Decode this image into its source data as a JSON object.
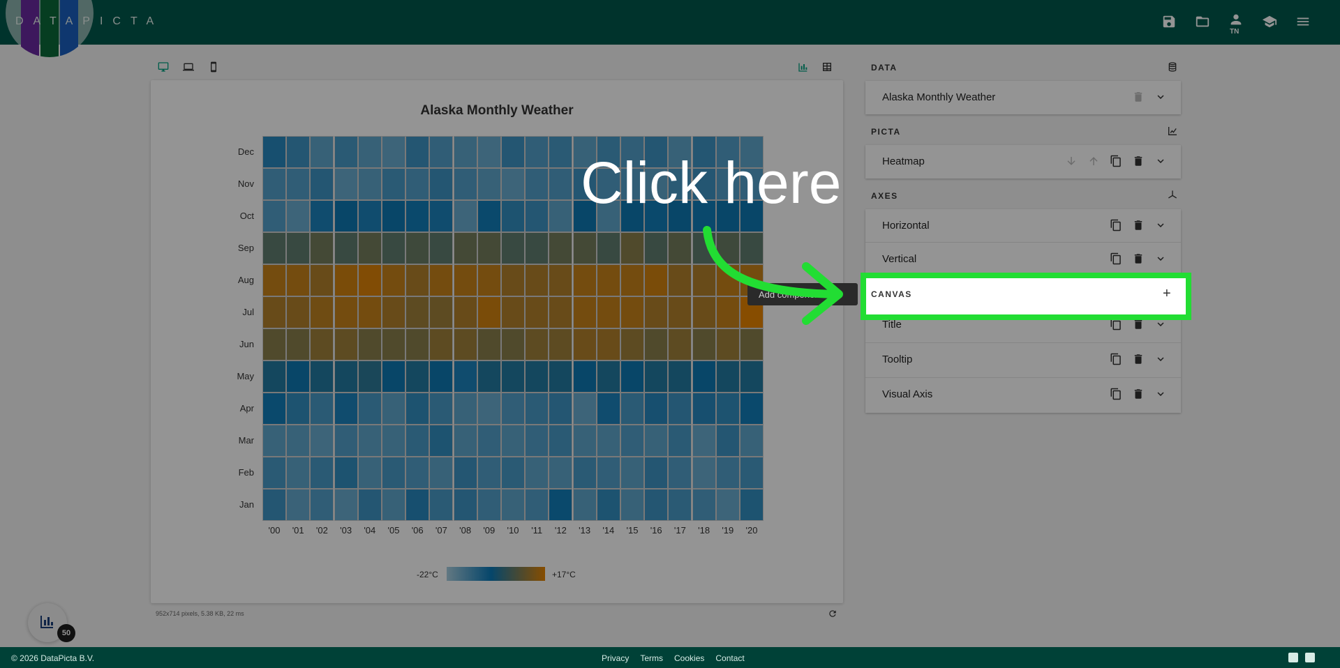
{
  "app": {
    "logo_text": "DATAPICTA",
    "user_initials": "TN"
  },
  "chart": {
    "title": "Alaska Monthly Weather",
    "legend_min": "-22°C",
    "legend_max": "+17°C",
    "stats": "952x714 pixels, 5.38 KB, 22 ms",
    "fab_badge": "50"
  },
  "chart_data": {
    "type": "heatmap",
    "title": "Alaska Monthly Weather",
    "x": [
      "'00",
      "'01",
      "'02",
      "'03",
      "'04",
      "'05",
      "'06",
      "'07",
      "'08",
      "'09",
      "'10",
      "'11",
      "'12",
      "'13",
      "'14",
      "'15",
      "'16",
      "'17",
      "'18",
      "'19",
      "'20"
    ],
    "y": [
      "Jan",
      "Feb",
      "Mar",
      "Apr",
      "May",
      "Jun",
      "Jul",
      "Aug",
      "Sep",
      "Oct",
      "Nov",
      "Dec"
    ],
    "color_range": [
      "-22°C",
      "+17°C"
    ],
    "colors": [
      "#a9cfe0",
      "#0a79b8",
      "#e88500"
    ],
    "values": [
      [
        -14,
        -21,
        -18,
        -22,
        -14,
        -20,
        -10,
        -16,
        -14,
        -18,
        -20,
        -18,
        -6,
        -20,
        -12,
        -20,
        -14,
        -16,
        -18,
        -22,
        -12
      ],
      [
        -16,
        -20,
        -16,
        -12,
        -20,
        -16,
        -18,
        -20,
        -14,
        -18,
        -16,
        -20,
        -20,
        -16,
        -18,
        -20,
        -14,
        -18,
        -22,
        -18,
        -16
      ],
      [
        -20,
        -20,
        -22,
        -18,
        -20,
        -20,
        -16,
        -12,
        -20,
        -18,
        -20,
        -18,
        -16,
        -20,
        -20,
        -18,
        -20,
        -16,
        -22,
        -14,
        -20
      ],
      [
        -6,
        -12,
        -16,
        -8,
        -16,
        -20,
        -12,
        -16,
        -20,
        -22,
        -18,
        -16,
        -14,
        -22,
        -8,
        -16,
        -10,
        -14,
        -10,
        -12,
        -6
      ],
      [
        -2,
        -4,
        -2,
        -2,
        -1,
        -4,
        -2,
        -4,
        -8,
        -2,
        -2,
        -2,
        -2,
        -4,
        -2,
        -4,
        -2,
        -2,
        -4,
        -2,
        -2
      ],
      [
        8,
        8,
        10,
        10,
        8,
        8,
        8,
        10,
        10,
        8,
        8,
        10,
        10,
        12,
        12,
        10,
        8,
        10,
        8,
        10,
        8
      ],
      [
        12,
        12,
        13,
        14,
        14,
        12,
        10,
        10,
        12,
        15,
        12,
        12,
        12,
        14,
        14,
        14,
        12,
        12,
        12,
        14,
        17
      ],
      [
        14,
        14,
        12,
        15,
        16,
        14,
        12,
        14,
        14,
        14,
        12,
        12,
        12,
        14,
        14,
        14,
        15,
        12,
        12,
        14,
        14
      ],
      [
        4,
        4,
        6,
        4,
        6,
        4,
        5,
        4,
        6,
        6,
        4,
        4,
        6,
        6,
        4,
        8,
        4,
        6,
        4,
        5,
        4
      ],
      [
        -18,
        -22,
        -8,
        -4,
        -8,
        -4,
        -6,
        -8,
        -22,
        -6,
        -12,
        -14,
        -20,
        -4,
        -20,
        -4,
        -6,
        -4,
        -6,
        -4,
        -4
      ],
      [
        -18,
        -18,
        -14,
        -22,
        -20,
        -16,
        -18,
        -14,
        -18,
        -20,
        -22,
        -18,
        -18,
        -14,
        -18,
        -18,
        -20,
        -16,
        -14,
        -18,
        -18
      ],
      [
        -10,
        -14,
        -20,
        -16,
        -20,
        -22,
        -14,
        -18,
        -20,
        -22,
        -14,
        -18,
        -16,
        -20,
        -16,
        -18,
        -14,
        -20,
        -14,
        -18,
        -20
      ]
    ]
  },
  "panel": {
    "data_heading": "DATA",
    "data_item": "Alaska Monthly Weather",
    "picta_heading": "PICTA",
    "picta_item": "Heatmap",
    "axes_heading": "AXES",
    "axes_items": [
      "Horizontal",
      "Vertical"
    ],
    "canvas_heading": "CANVAS",
    "canvas_items": [
      "Title",
      "Tooltip",
      "Visual Axis"
    ],
    "hidden_tooltip": "Add component"
  },
  "overlay": {
    "instruction": "Click here",
    "plus_symbol": "+"
  },
  "footer": {
    "copyright": "© 2026 DataPicta B.V.",
    "links": [
      "Privacy",
      "Terms",
      "Cookies",
      "Contact"
    ]
  }
}
